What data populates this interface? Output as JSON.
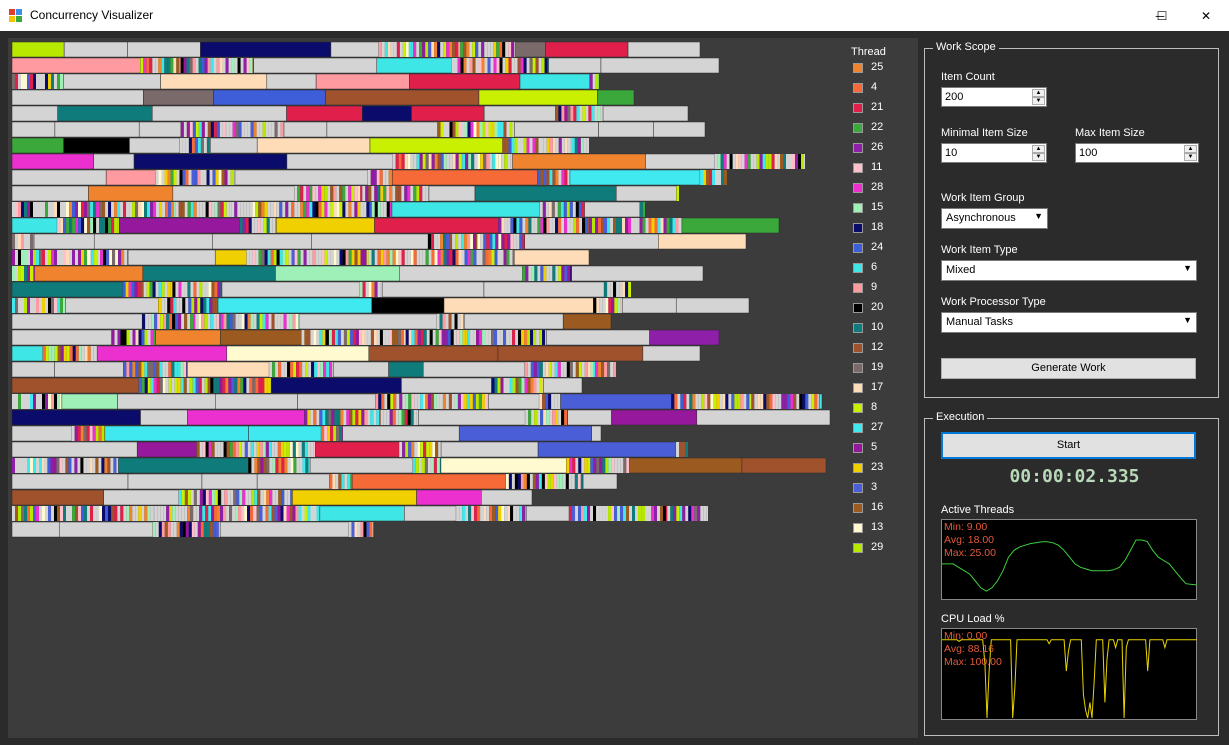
{
  "window": {
    "title": "Concurrency Visualizer",
    "minimize_glyph": "─",
    "maximize_glyph": "☐",
    "close_glyph": "✕"
  },
  "legend": {
    "title": "Thread",
    "items": [
      {
        "label": "25",
        "color": "#f0842e"
      },
      {
        "label": "4",
        "color": "#f56a37"
      },
      {
        "label": "21",
        "color": "#e0204a"
      },
      {
        "label": "22",
        "color": "#3aa83a"
      },
      {
        "label": "26",
        "color": "#8e1fa8"
      },
      {
        "label": "11",
        "color": "#ffc0cb"
      },
      {
        "label": "28",
        "color": "#ec2fcf"
      },
      {
        "label": "15",
        "color": "#9ff0b8"
      },
      {
        "label": "18",
        "color": "#0b0b6b"
      },
      {
        "label": "24",
        "color": "#3d5ed8"
      },
      {
        "label": "6",
        "color": "#3ee6e6"
      },
      {
        "label": "9",
        "color": "#ff9aa0"
      },
      {
        "label": "20",
        "color": "#000000"
      },
      {
        "label": "10",
        "color": "#0f7b7b"
      },
      {
        "label": "12",
        "color": "#a0522d"
      },
      {
        "label": "19",
        "color": "#7a6a6a"
      },
      {
        "label": "17",
        "color": "#ffdcb8"
      },
      {
        "label": "8",
        "color": "#c8f000"
      },
      {
        "label": "27",
        "color": "#40e8f0"
      },
      {
        "label": "5",
        "color": "#96189c"
      },
      {
        "label": "23",
        "color": "#f0d000"
      },
      {
        "label": "3",
        "color": "#4a5ed8"
      },
      {
        "label": "16",
        "color": "#9a5a20"
      },
      {
        "label": "13",
        "color": "#fffad0"
      },
      {
        "label": "29",
        "color": "#b8e800"
      }
    ]
  },
  "work_scope": {
    "title": "Work Scope",
    "item_count_label": "Item Count",
    "item_count_value": "200",
    "min_size_label": "Minimal Item Size",
    "min_size_value": "10",
    "max_size_label": "Max Item Size",
    "max_size_value": "100",
    "group_label": "Work Item Group",
    "group_value": "Asynchronous",
    "type_label": "Work Item Type",
    "type_value": "Mixed",
    "processor_label": "Work Processor Type",
    "processor_value": "Manual Tasks",
    "generate_label": "Generate Work"
  },
  "execution": {
    "title": "Execution",
    "start_label": "Start",
    "timer": "00:00:02.335",
    "threads_label": "Active Threads",
    "threads_stats": {
      "min": "Min: 9.00",
      "avg": "Avg: 18.00",
      "max": "Max: 25.00"
    },
    "threads_series": [
      18,
      18,
      18,
      17,
      16,
      15,
      13,
      11,
      10,
      11,
      13,
      16,
      20,
      22,
      23,
      23.5,
      24,
      24.2,
      24.5,
      24.5,
      24.2,
      23.5,
      22,
      20,
      18,
      17,
      16.5,
      16,
      16,
      16,
      16,
      16.3,
      17,
      19,
      22,
      25,
      25,
      24.6,
      22,
      20,
      19,
      18,
      16,
      14,
      12.2,
      12,
      11.8
    ],
    "cpu_label": "CPU Load %",
    "cpu_stats": {
      "min": "Min: 0.00",
      "avg": "Avg: 88.16",
      "max": "Max: 100.00"
    },
    "cpu_series": [
      100,
      100,
      100,
      100,
      100,
      100,
      100,
      100,
      98,
      100,
      100,
      100,
      100,
      100,
      100,
      100,
      100,
      100,
      100,
      100,
      100,
      100,
      100,
      100,
      100,
      100,
      100,
      100,
      100,
      100,
      100,
      100,
      100,
      100,
      100,
      100,
      100,
      100,
      100,
      100,
      100,
      100,
      100,
      100,
      100,
      100,
      100,
      100,
      100,
      100,
      95,
      100,
      100,
      100,
      100,
      100,
      100,
      100,
      100,
      100,
      100,
      100,
      100,
      100,
      100,
      100,
      100,
      100,
      100,
      100,
      100,
      100,
      100,
      100,
      100,
      100,
      100,
      100,
      100,
      100,
      100,
      90,
      100,
      100,
      100,
      100,
      100,
      100,
      100,
      100,
      100,
      100,
      100,
      100,
      100,
      100,
      100,
      100,
      100,
      100,
      100,
      100,
      100,
      100,
      100,
      100,
      100,
      100,
      100,
      100,
      100,
      100,
      100,
      100,
      100,
      100,
      100,
      100,
      100,
      100
    ]
  }
}
